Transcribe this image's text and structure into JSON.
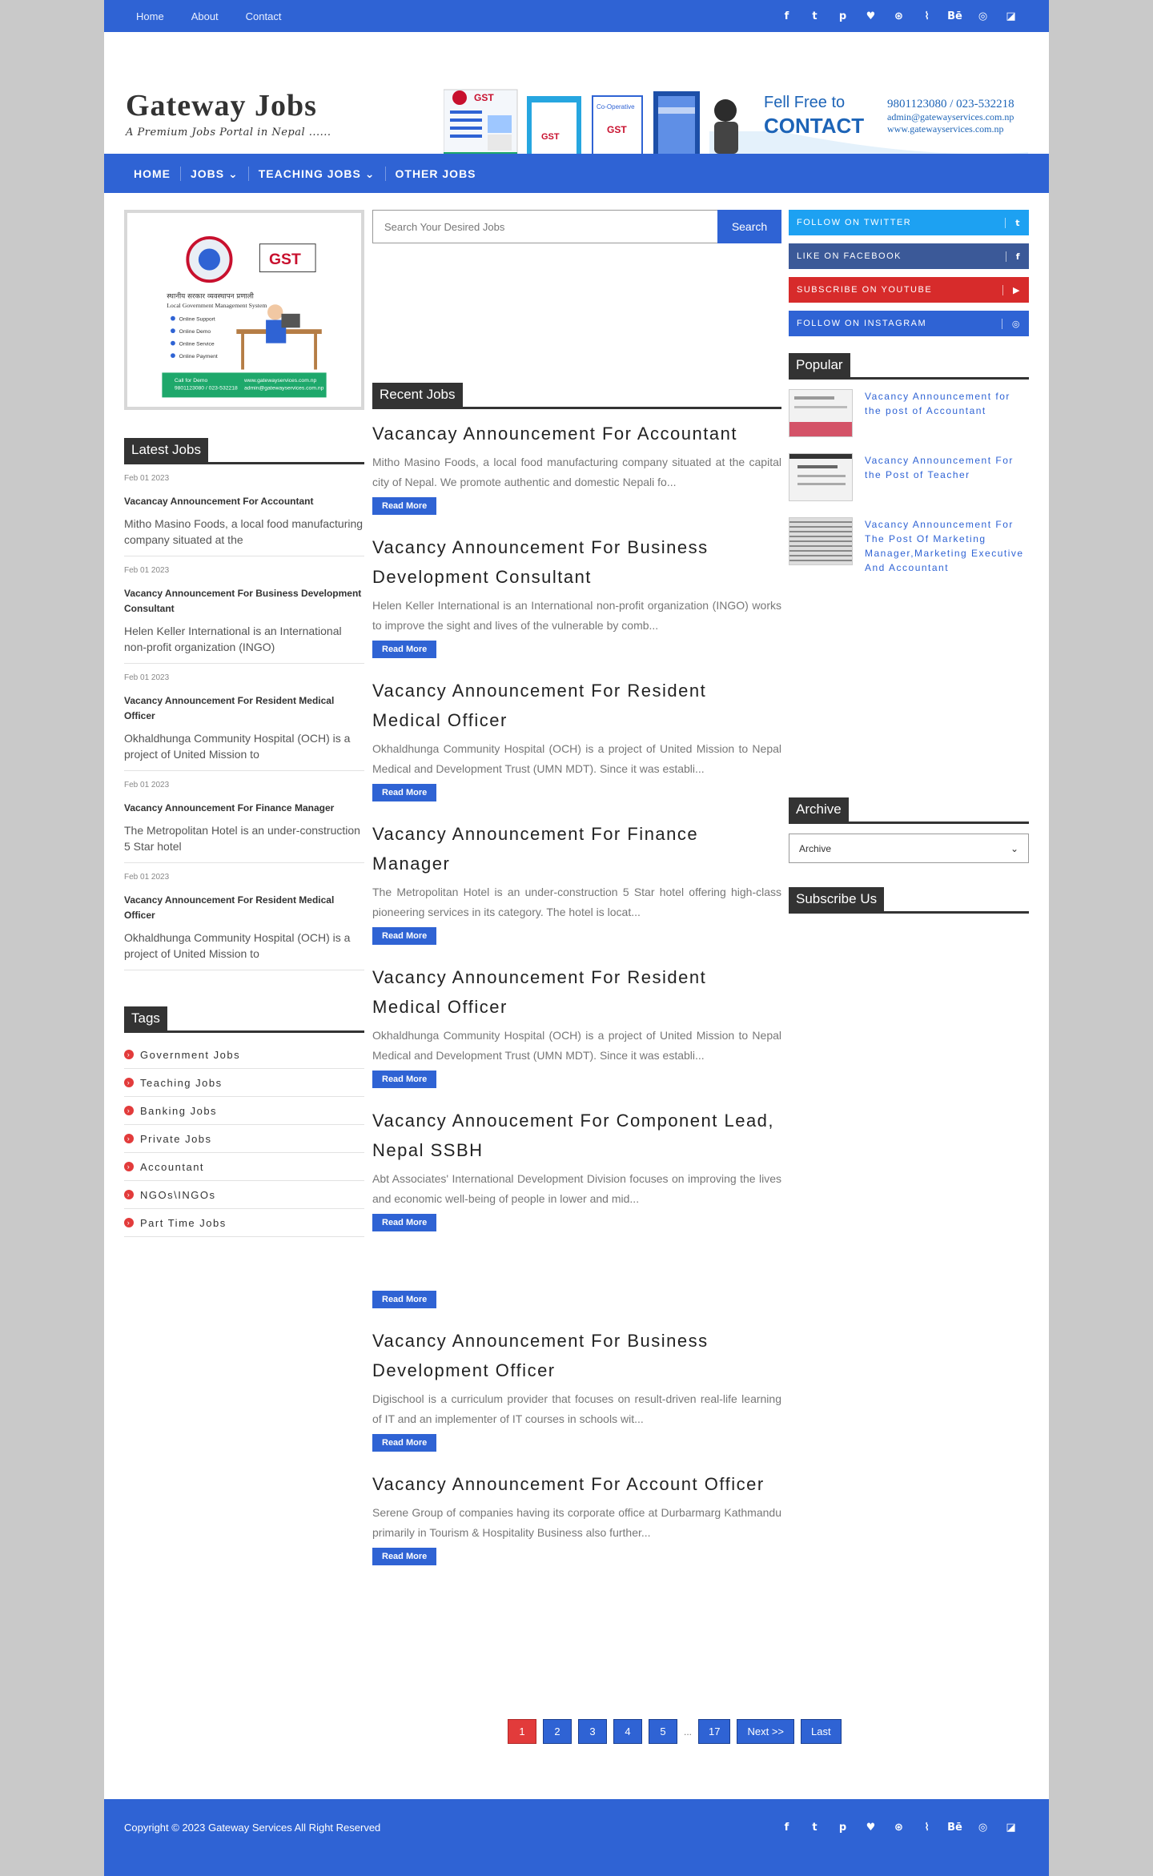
{
  "topbar": {
    "links": [
      "Home",
      "About",
      "Contact"
    ],
    "social_icons": [
      "facebook-icon",
      "twitter-icon",
      "pinterest-icon",
      "heart-icon",
      "dribbble-icon",
      "rss-icon",
      "behance-icon",
      "instagram-icon",
      "delicious-icon"
    ],
    "social_glyphs": [
      "f",
      "t",
      "p",
      "♥",
      "⊛",
      "⌇",
      "Bē",
      "◎",
      "◪"
    ]
  },
  "header": {
    "title": "Gateway Jobs",
    "tagline": "A Premium Jobs Portal in Nepal ......",
    "banner": {
      "cta_line1": "Fell Free to",
      "cta_line2": "CONTACT",
      "phone": "9801123080 / 023-532218",
      "email": "admin@gatewayservices.com.np",
      "web": "www.gatewayservices.com.np",
      "box_labels": [
        "GST",
        "GST",
        "Co-Operative",
        ""
      ]
    }
  },
  "nav": {
    "items": [
      "HOME",
      "JOBS ⌄",
      "TEACHING JOBS ⌄",
      "OTHER JOBS"
    ]
  },
  "left_ad": {
    "logo": "GST",
    "heading": "स्थानीय सरकार व्यवस्थापन प्रणाली",
    "subheading": "Local Government Management System",
    "features": [
      "Online Support",
      "Online Demo",
      "Online Service",
      "Online Payment"
    ],
    "footer_line1": "Call for Demo",
    "footer_line2": "9801123080 / 023-532218",
    "footer_line3": "www.gatewayservices.com.np",
    "footer_line4": "admin@gatewayservices.com.np"
  },
  "latest": {
    "title": "Latest Jobs",
    "items": [
      {
        "date": "Feb 01 2023",
        "title": "Vacancay Announcement For Accountant",
        "desc": " Mitho Masino Foods, a local food manufacturing company situated at the"
      },
      {
        "date": "Feb 01 2023",
        "title": "Vacancy Announcement For Business Development Consultant",
        "desc": "Helen Keller International is an International non-profit organization (INGO)"
      },
      {
        "date": "Feb 01 2023",
        "title": "Vacancy Announcement For Resident Medical Officer",
        "desc": " Okhaldhunga Community Hospital (OCH) is a project of United Mission to"
      },
      {
        "date": "Feb 01 2023",
        "title": "Vacancy Announcement For Finance Manager",
        "desc": " The Metropolitan Hotel is an under-construction 5 Star hotel"
      },
      {
        "date": "Feb 01 2023",
        "title": "Vacancy Announcement For Resident Medical Officer",
        "desc": " Okhaldhunga Community Hospital (OCH) is a project of United Mission to"
      }
    ]
  },
  "tags": {
    "title": "Tags",
    "items": [
      "Government Jobs",
      "Teaching Jobs",
      "Banking Jobs",
      "Private Jobs",
      "Accountant",
      "NGOs\\INGOs",
      "Part Time Jobs"
    ]
  },
  "search": {
    "placeholder": "Search Your Desired Jobs",
    "button": "Search"
  },
  "recent": {
    "title": "Recent Jobs",
    "read_more": "Read More",
    "posts": [
      {
        "title": "Vacancay Announcement For Accountant",
        "desc": "  Mitho Masino Foods, a local food manufacturing company situated at the capital city of Nepal.  We promote authentic and domestic Nepali fo..."
      },
      {
        "title": "Vacancy Announcement For Business Development Consultant",
        "desc": "Helen Keller International is an International non-profit organization (INGO) works to improve the sight and lives of the vulnerable by comb..."
      },
      {
        "title": "Vacancy Announcement For Resident Medical Officer",
        "desc": "  Okhaldhunga Community Hospital (OCH) is a project of United Mission to Nepal Medical and Development Trust (UMN MDT). Since it was establi..."
      },
      {
        "title": "Vacancy Announcement For Finance Manager",
        "desc": "  The Metropolitan Hotel   is an under-construction 5 Star hotel offering high-class pioneering services in its category. The hotel is locat..."
      },
      {
        "title": "Vacancy Announcement For Resident Medical Officer",
        "desc": "  Okhaldhunga Community Hospital (OCH) is a project of United Mission to Nepal Medical and Development Trust (UMN MDT). Since it was establi..."
      },
      {
        "title": "Vacancy Annoucement For Component Lead, Nepal SSBH",
        "desc": "  Abt Associates'    International Development Division focuses on improving the lives and economic well-being of people in lower and mid..."
      },
      {
        "title": "",
        "desc": ""
      },
      {
        "title": "Vacancy Announcement For Business Development Officer",
        "desc": "  Digischool is a curriculum provider that focuses on result-driven real-life learning of IT and an implementer of IT courses in schools wit..."
      },
      {
        "title": "Vacancy Announcement For Account Officer",
        "desc": "  Serene Group of companies having its corporate office at Durbarmarg Kathmandu primarily in Tourism & Hospitality Business also further..."
      }
    ]
  },
  "pager": {
    "pages": [
      "1",
      "2",
      "3",
      "4",
      "5"
    ],
    "dots": "...",
    "last_page": "17",
    "next": "Next >>",
    "last": "Last"
  },
  "follow": {
    "items": [
      {
        "label": "FOLLOW ON TWITTER",
        "glyph": "t",
        "color": "#1da1f2"
      },
      {
        "label": "LIKE ON FACEBOOK",
        "glyph": "f",
        "color": "#3b5998"
      },
      {
        "label": "SUBSCRIBE ON YOUTUBE",
        "glyph": "▶",
        "color": "#d72b2b"
      },
      {
        "label": "FOLLOW ON INSTAGRAM",
        "glyph": "◎",
        "color": "#2f63d4"
      }
    ]
  },
  "popular": {
    "title": "Popular",
    "items": [
      "Vacancy Announcement for the post of Accountant",
      "Vacancy Announcement For the Post of Teacher",
      "Vacancy Announcement For The Post Of Marketing Manager,Marketing Executive And Accountant"
    ]
  },
  "archive": {
    "title": "Archive",
    "selected": "Archive"
  },
  "subscribe": {
    "title": "Subscribe Us"
  },
  "footer": {
    "copyright": "Copyright © 2023 Gateway Services All Right Reserved"
  },
  "colors": {
    "primary": "#2f63d4",
    "accent_red": "#e23b3b",
    "dark": "#333333"
  }
}
